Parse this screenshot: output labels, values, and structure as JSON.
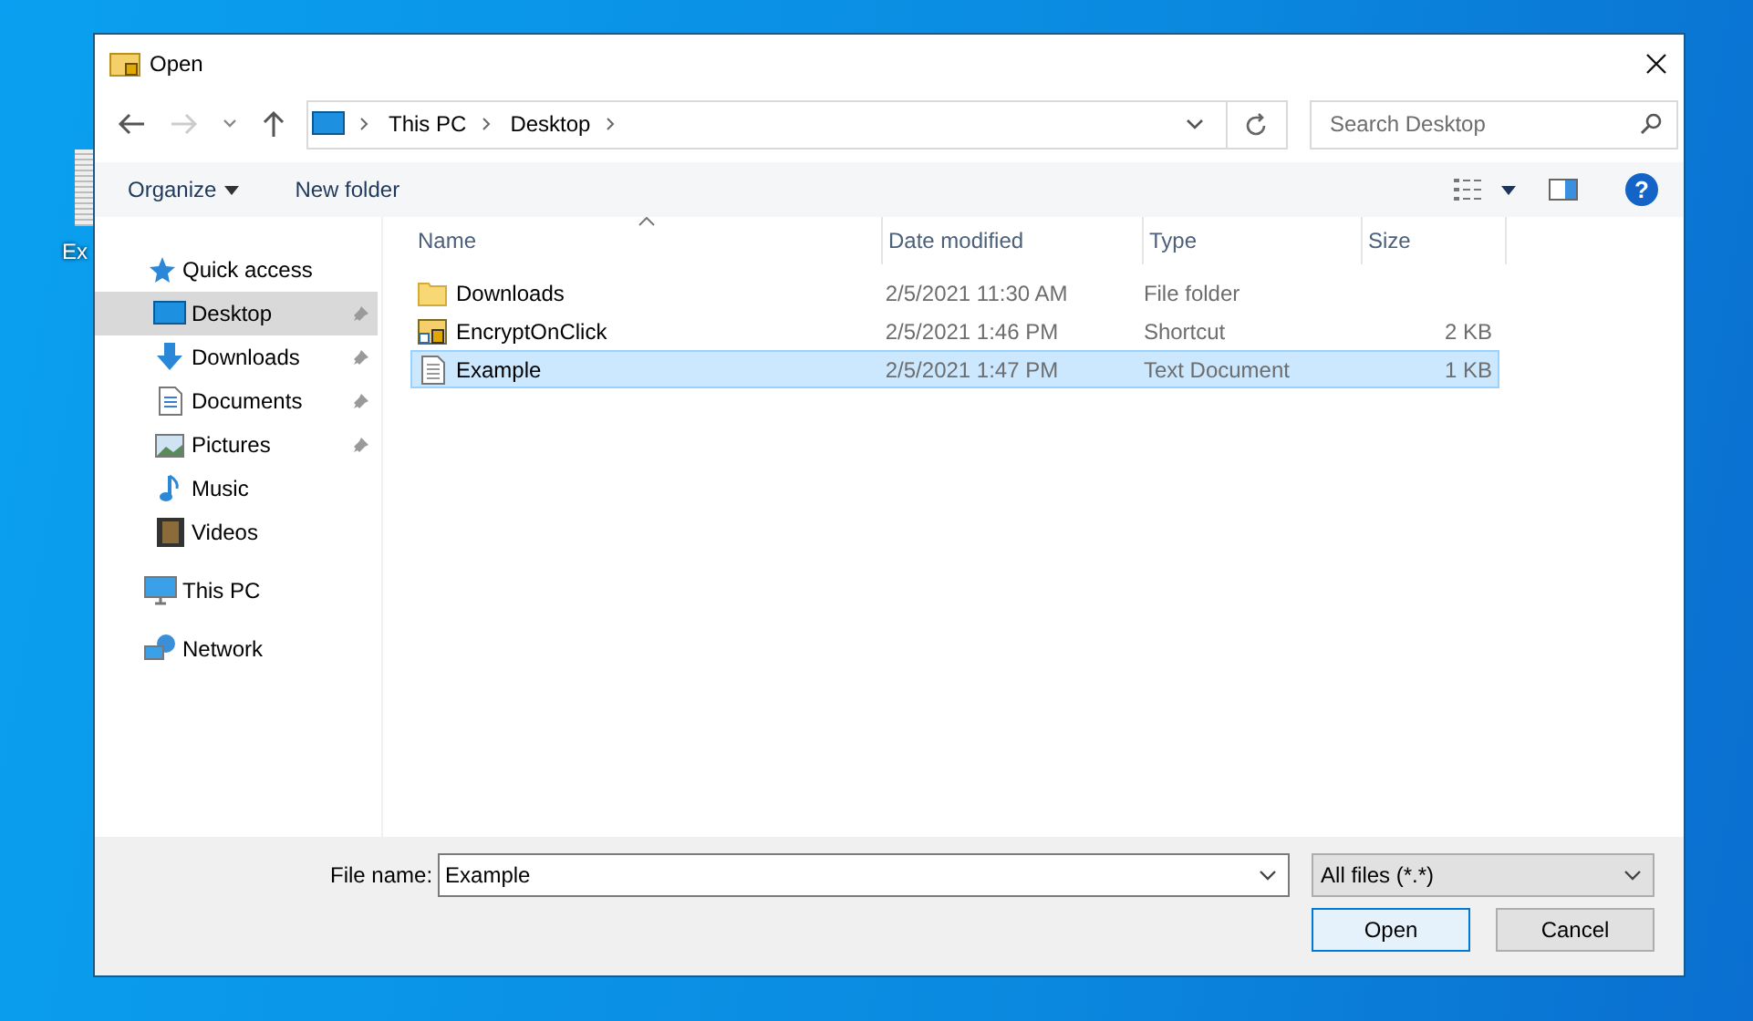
{
  "desktop_icons": [
    {
      "label": "Ex"
    }
  ],
  "window": {
    "title": "Open"
  },
  "address": {
    "path": [
      "This PC",
      "Desktop"
    ]
  },
  "search": {
    "placeholder": "Search Desktop"
  },
  "toolbar": {
    "organize": "Organize",
    "new_folder": "New folder",
    "help": "?"
  },
  "sidebar": {
    "items": [
      {
        "label": "Quick access",
        "kind": "star",
        "selected": false,
        "pinned": false,
        "children": [
          {
            "label": "Desktop",
            "kind": "desktop",
            "selected": true,
            "pinned": true
          },
          {
            "label": "Downloads",
            "kind": "download",
            "selected": false,
            "pinned": true
          },
          {
            "label": "Documents",
            "kind": "document",
            "selected": false,
            "pinned": true
          },
          {
            "label": "Pictures",
            "kind": "picture",
            "selected": false,
            "pinned": true
          },
          {
            "label": "Music",
            "kind": "music",
            "selected": false,
            "pinned": false
          },
          {
            "label": "Videos",
            "kind": "video",
            "selected": false,
            "pinned": false
          }
        ]
      },
      {
        "label": "This PC",
        "kind": "computer",
        "selected": false,
        "pinned": false
      },
      {
        "label": "Network",
        "kind": "network",
        "selected": false,
        "pinned": false
      }
    ]
  },
  "table": {
    "columns": [
      {
        "label": "Name",
        "sorted": true
      },
      {
        "label": "Date modified",
        "sorted": false
      },
      {
        "label": "Type",
        "sorted": false
      },
      {
        "label": "Size",
        "sorted": false
      }
    ],
    "rows": [
      {
        "name": "Downloads",
        "kind": "folder",
        "date": "2/5/2021 11:30 AM",
        "type": "File folder",
        "selected": false
      },
      {
        "name": "EncryptOnClick",
        "kind": "shortcut",
        "date": "2/5/2021 1:46 PM",
        "type": "Shortcut",
        "size": "2 KB",
        "selected": false
      },
      {
        "name": "Example",
        "kind": "text",
        "date": "2/5/2021 1:47 PM",
        "type": "Text Document",
        "size": "1 KB",
        "selected": true
      }
    ]
  },
  "file_name": {
    "label": "File name:",
    "value": "Example"
  },
  "file_type": {
    "value": "All files (*.*)"
  },
  "buttons": [
    {
      "label": "Open",
      "default": true
    },
    {
      "label": "Cancel",
      "default": false
    }
  ]
}
